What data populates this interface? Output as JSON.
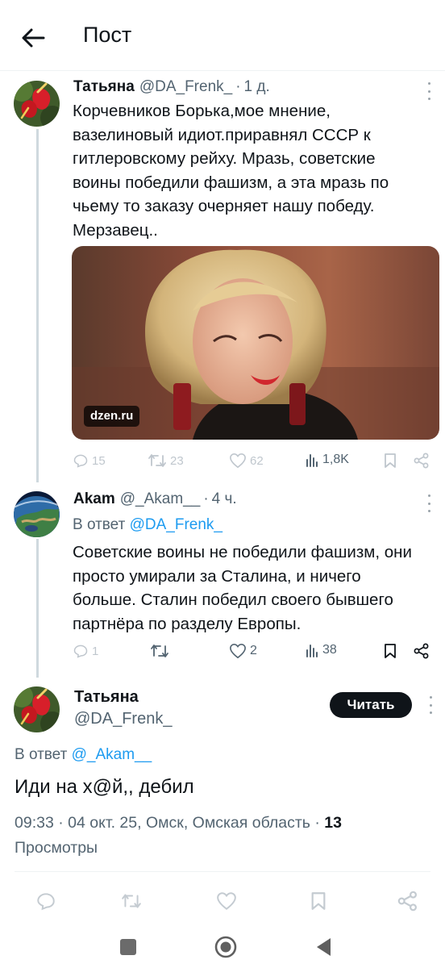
{
  "header": {
    "title": "Пост",
    "back_icon": "arrow-left-icon"
  },
  "tweet1": {
    "author_name": "Татьяна",
    "author_handle": "@DA_Frenk_",
    "separator": "·",
    "time": "1 д.",
    "lines": [
      "Корчевников Борька,мое мнение,",
      "вазелиновый идиот.приравнял СССР к",
      "гитлеровскому рейху. Мразь, советские",
      "воины победили фашизм, а эта мразь по",
      "чьему то заказу очерняет нашу победу.",
      "Мерзавец.."
    ],
    "media_source": "dzen.ru",
    "stats": {
      "replies": "15",
      "reposts": "23",
      "likes": "62",
      "views": "1,8K"
    }
  },
  "tweet2": {
    "author_name": "Akam",
    "author_handle": "@_Akam__",
    "separator": "·",
    "time": "4 ч.",
    "reply_prefix": "В ответ",
    "reply_handle": "@DA_Frenk_",
    "lines": [
      "Советские воины не победили фашизм, они",
      "просто умирали за Сталина, и ничего",
      "больше. Сталин победил своего бывшего",
      "партнёра по разделу Европы."
    ],
    "stats": {
      "replies": "1",
      "reposts": "",
      "likes": "2",
      "views": "38"
    }
  },
  "focus": {
    "author_name": "Татьяна",
    "author_handle": "@DA_Frenk_",
    "follow_label": "Читать",
    "reply_prefix": "В ответ",
    "reply_handle": "@_Akam__",
    "text": "Иди на х@й,, дебил",
    "meta_line": "09:33 · 04 окт. 25, Омск, Омская область · ",
    "views_count": "13",
    "views_label": "Просмотры"
  },
  "colors": {
    "accent": "#1d9bf0",
    "text": "#0f1419",
    "muted": "#536471",
    "thread_line": "#cfd9de"
  }
}
